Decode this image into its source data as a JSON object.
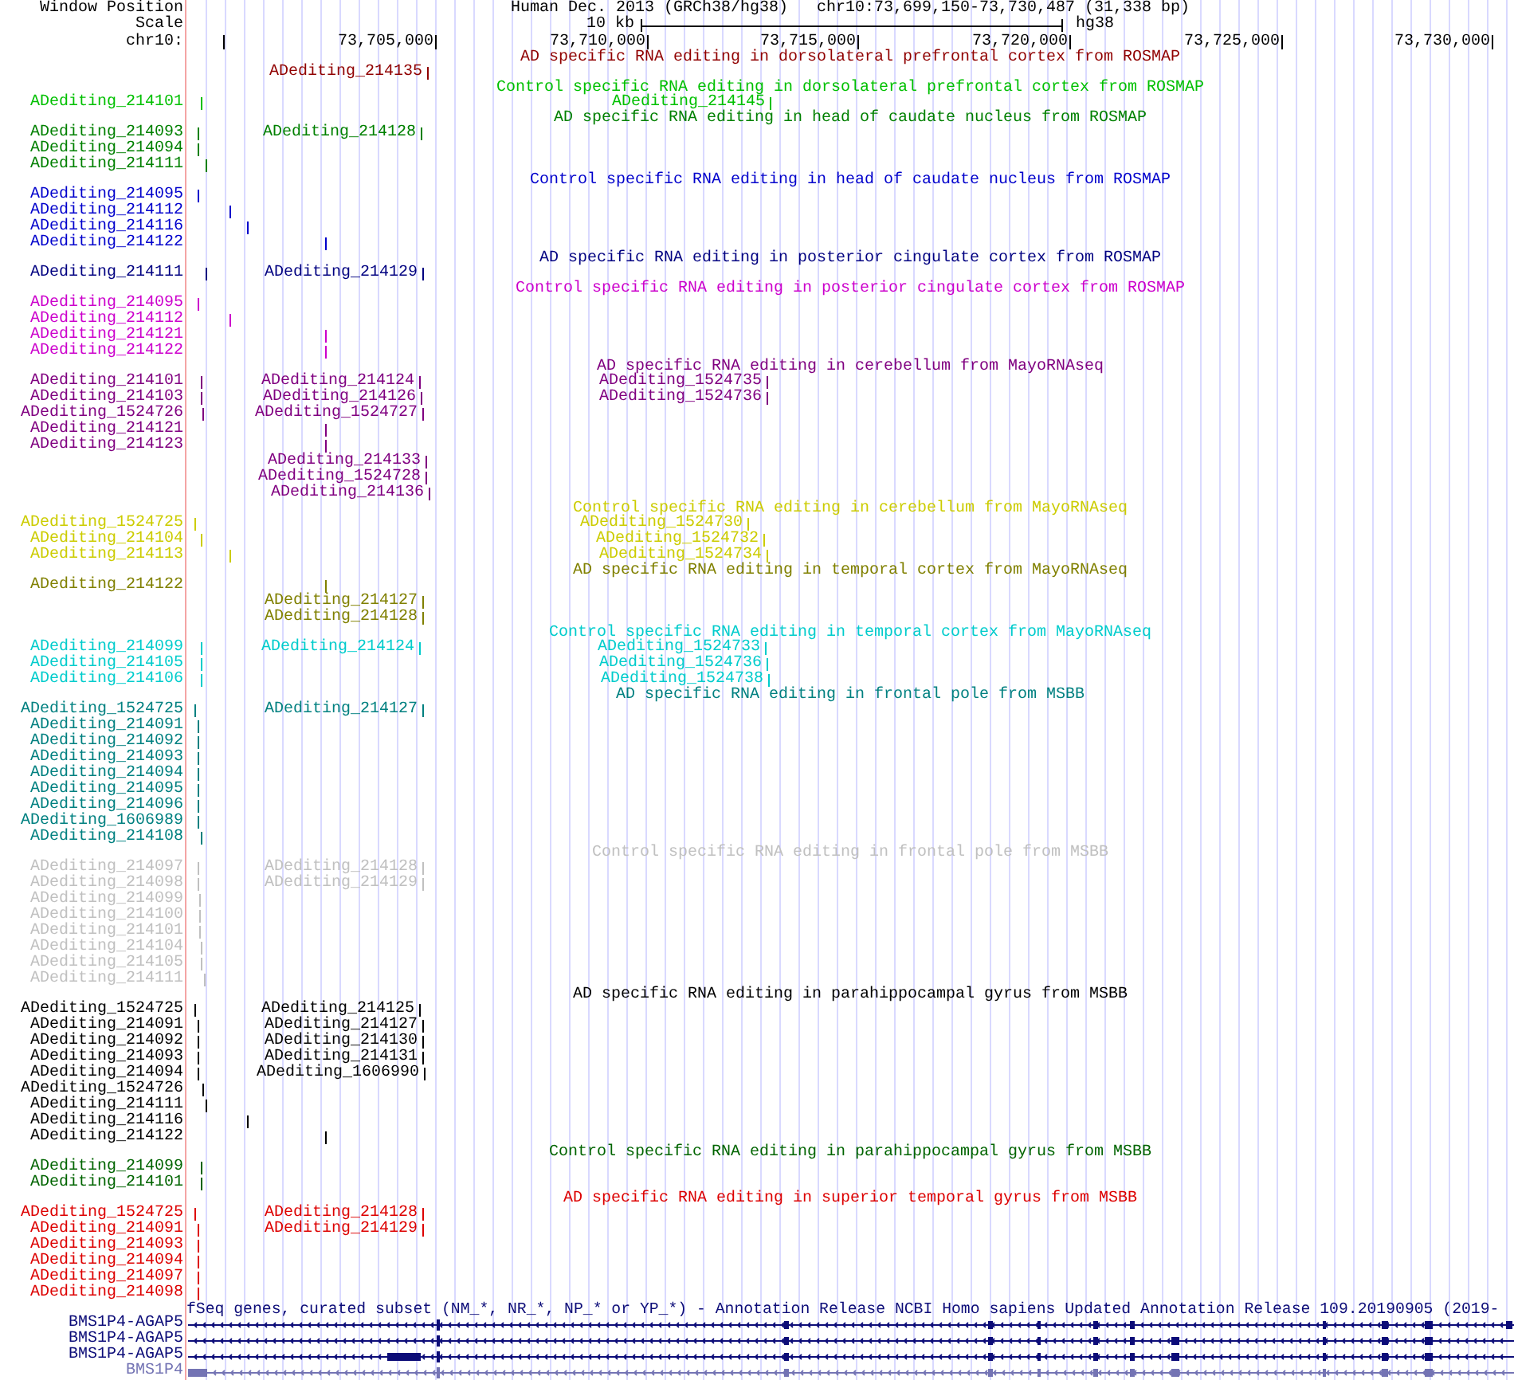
{
  "header": {
    "label": "Window Position",
    "assembly": "Human Dec. 2013 (GRCh38/hg38)",
    "position": "chr10:73,699,150-73,730,487 (31,338 bp)"
  },
  "scale": {
    "label": "Scale",
    "length": "10 kb",
    "assembly": "hg38"
  },
  "ruler": {
    "label": "chr10:",
    "ticks": [
      "73,705,000",
      "73,710,000",
      "73,715,000",
      "73,720,000",
      "73,725,000",
      "73,730,000"
    ]
  },
  "tracks": [
    {
      "kind": "sites",
      "title": "AD specific RNA editing in dorsolateral prefrontal cortex from ROSMAP",
      "color": "#900000",
      "rows": [
        {
          "features": [
            "ADediting_214135"
          ]
        }
      ]
    },
    {
      "kind": "sites",
      "title": "Control specific RNA editing in dorsolateral prefrontal cortex from ROSMAP",
      "color": "#00c000",
      "rows": [
        {
          "features": [
            "ADediting_214101",
            "ADediting_214145"
          ]
        }
      ]
    },
    {
      "kind": "sites",
      "title": "AD specific RNA editing in head of caudate nucleus from ROSMAP",
      "color": "#008000",
      "rows": [
        {
          "features": [
            "ADediting_214093",
            "ADediting_214128"
          ]
        },
        {
          "features": [
            "ADediting_214094"
          ]
        },
        {
          "features": [
            "ADediting_214111"
          ]
        }
      ]
    },
    {
      "kind": "sites",
      "title": "Control specific RNA editing in head of caudate nucleus from ROSMAP",
      "color": "#0000cc",
      "rows": [
        {
          "features": [
            "ADediting_214095"
          ]
        },
        {
          "features": [
            "ADediting_214112"
          ]
        },
        {
          "features": [
            "ADediting_214116"
          ]
        },
        {
          "features": [
            "ADediting_214122"
          ]
        }
      ]
    },
    {
      "kind": "sites",
      "title": "AD specific RNA editing in posterior cingulate cortex from ROSMAP",
      "color": "#000080",
      "rows": [
        {
          "features": [
            "ADediting_214111",
            "ADediting_214129"
          ]
        }
      ]
    },
    {
      "kind": "sites",
      "title": "Control specific RNA editing in posterior cingulate cortex from ROSMAP",
      "color": "#cc00cc",
      "rows": [
        {
          "features": [
            "ADediting_214095"
          ]
        },
        {
          "features": [
            "ADediting_214112"
          ]
        },
        {
          "features": [
            "ADediting_214121"
          ]
        },
        {
          "features": [
            "ADediting_214122"
          ]
        }
      ]
    },
    {
      "kind": "sites",
      "title": "AD specific RNA editing in cerebellum from MayoRNAseq",
      "color": "#800080",
      "rows": [
        {
          "features": [
            "ADediting_214101",
            "ADediting_214124",
            "ADediting_1524735"
          ]
        },
        {
          "features": [
            "ADediting_214103",
            "ADediting_214126",
            "ADediting_1524736"
          ]
        },
        {
          "features": [
            "ADediting_1524726",
            "ADediting_1524727"
          ]
        },
        {
          "features": [
            "ADediting_214121"
          ]
        },
        {
          "features": [
            "ADediting_214123"
          ]
        },
        {
          "features": [
            "ADediting_214133"
          ]
        },
        {
          "features": [
            "ADediting_1524728"
          ]
        },
        {
          "features": [
            "ADediting_214136"
          ]
        }
      ]
    },
    {
      "kind": "sites",
      "title": "Control specific RNA editing in cerebellum from MayoRNAseq",
      "color": "#cccc00",
      "rows": [
        {
          "features": [
            "ADediting_1524725",
            "ADediting_1524730"
          ]
        },
        {
          "features": [
            "ADediting_214104",
            "ADediting_1524732"
          ]
        },
        {
          "features": [
            "ADediting_214113",
            "ADediting_1524734"
          ]
        }
      ]
    },
    {
      "kind": "sites",
      "title": "AD specific RNA editing in temporal cortex from MayoRNAseq",
      "color": "#808000",
      "rows": [
        {
          "features": [
            "ADediting_214122"
          ]
        },
        {
          "features": [
            "ADediting_214127"
          ]
        },
        {
          "features": [
            "ADediting_214128"
          ]
        }
      ]
    },
    {
      "kind": "sites",
      "title": "Control specific RNA editing in temporal cortex from MayoRNAseq",
      "color": "#00cccc",
      "rows": [
        {
          "features": [
            "ADediting_214099",
            "ADediting_214124",
            "ADediting_1524733"
          ]
        },
        {
          "features": [
            "ADediting_214105",
            "ADediting_1524736"
          ]
        },
        {
          "features": [
            "ADediting_214106",
            "ADediting_1524738"
          ]
        }
      ]
    },
    {
      "kind": "sites",
      "title": "AD specific RNA editing in frontal pole from MSBB",
      "color": "#008080",
      "rows": [
        {
          "features": [
            "ADediting_1524725",
            "ADediting_214127"
          ]
        },
        {
          "features": [
            "ADediting_214091"
          ]
        },
        {
          "features": [
            "ADediting_214092"
          ]
        },
        {
          "features": [
            "ADediting_214093"
          ]
        },
        {
          "features": [
            "ADediting_214094"
          ]
        },
        {
          "features": [
            "ADediting_214095"
          ]
        },
        {
          "features": [
            "ADediting_214096"
          ]
        },
        {
          "features": [
            "ADediting_1606989"
          ]
        },
        {
          "features": [
            "ADediting_214108"
          ]
        }
      ]
    },
    {
      "kind": "sites",
      "title": "Control specific RNA editing in frontal pole from MSBB",
      "color": "#c0c0c0",
      "rows": [
        {
          "features": [
            "ADediting_214097",
            "ADediting_214128"
          ]
        },
        {
          "features": [
            "ADediting_214098",
            "ADediting_214129"
          ]
        },
        {
          "features": [
            "ADediting_214099"
          ]
        },
        {
          "features": [
            "ADediting_214100"
          ]
        },
        {
          "features": [
            "ADediting_214101"
          ]
        },
        {
          "features": [
            "ADediting_214104"
          ]
        },
        {
          "features": [
            "ADediting_214105"
          ]
        },
        {
          "features": [
            "ADediting_214111"
          ]
        }
      ]
    },
    {
      "kind": "sites",
      "title": "AD specific RNA editing in parahippocampal gyrus from MSBB",
      "color": "#000000",
      "rows": [
        {
          "features": [
            "ADediting_1524725",
            "ADediting_214125"
          ]
        },
        {
          "features": [
            "ADediting_214091",
            "ADediting_214127"
          ]
        },
        {
          "features": [
            "ADediting_214092",
            "ADediting_214130"
          ]
        },
        {
          "features": [
            "ADediting_214093",
            "ADediting_214131"
          ]
        },
        {
          "features": [
            "ADediting_214094",
            "ADediting_1606990"
          ]
        },
        {
          "features": [
            "ADediting_1524726"
          ]
        },
        {
          "features": [
            "ADediting_214111"
          ]
        },
        {
          "features": [
            "ADediting_214116"
          ]
        },
        {
          "features": [
            "ADediting_214122"
          ]
        }
      ]
    },
    {
      "kind": "sites",
      "title": "Control specific RNA editing in parahippocampal gyrus from MSBB",
      "color": "#006400",
      "rows": [
        {
          "features": [
            "ADediting_214099"
          ]
        },
        {
          "features": [
            "ADediting_214101"
          ]
        }
      ]
    },
    {
      "kind": "sites",
      "title": "AD specific RNA editing in superior temporal gyrus from MSBB",
      "color": "#dd0000",
      "rows": [
        {
          "features": [
            "ADediting_1524725",
            "ADediting_214128"
          ]
        },
        {
          "features": [
            "ADediting_214091",
            "ADediting_214129"
          ]
        },
        {
          "features": [
            "ADediting_214093"
          ]
        },
        {
          "features": [
            "ADediting_214094"
          ]
        },
        {
          "features": [
            "ADediting_214097"
          ]
        },
        {
          "features": [
            "ADediting_214098"
          ]
        }
      ]
    },
    {
      "kind": "genes",
      "title": "fSeq genes, curated subset (NM_*, NR_*, NP_* or YP_*) - Annotation Release NCBI Homo sapiens Updated Annotation Release 109.20190905 (2019-",
      "color": "#0c0c78",
      "genes": [
        {
          "name": "BMS1P4-AGAP5",
          "color": "#0c0c78"
        },
        {
          "name": "BMS1P4-AGAP5",
          "color": "#0c0c78"
        },
        {
          "name": "BMS1P4-AGAP5",
          "color": "#0c0c78"
        },
        {
          "name": "BMS1P4",
          "color": "#7474b4"
        }
      ]
    }
  ]
}
